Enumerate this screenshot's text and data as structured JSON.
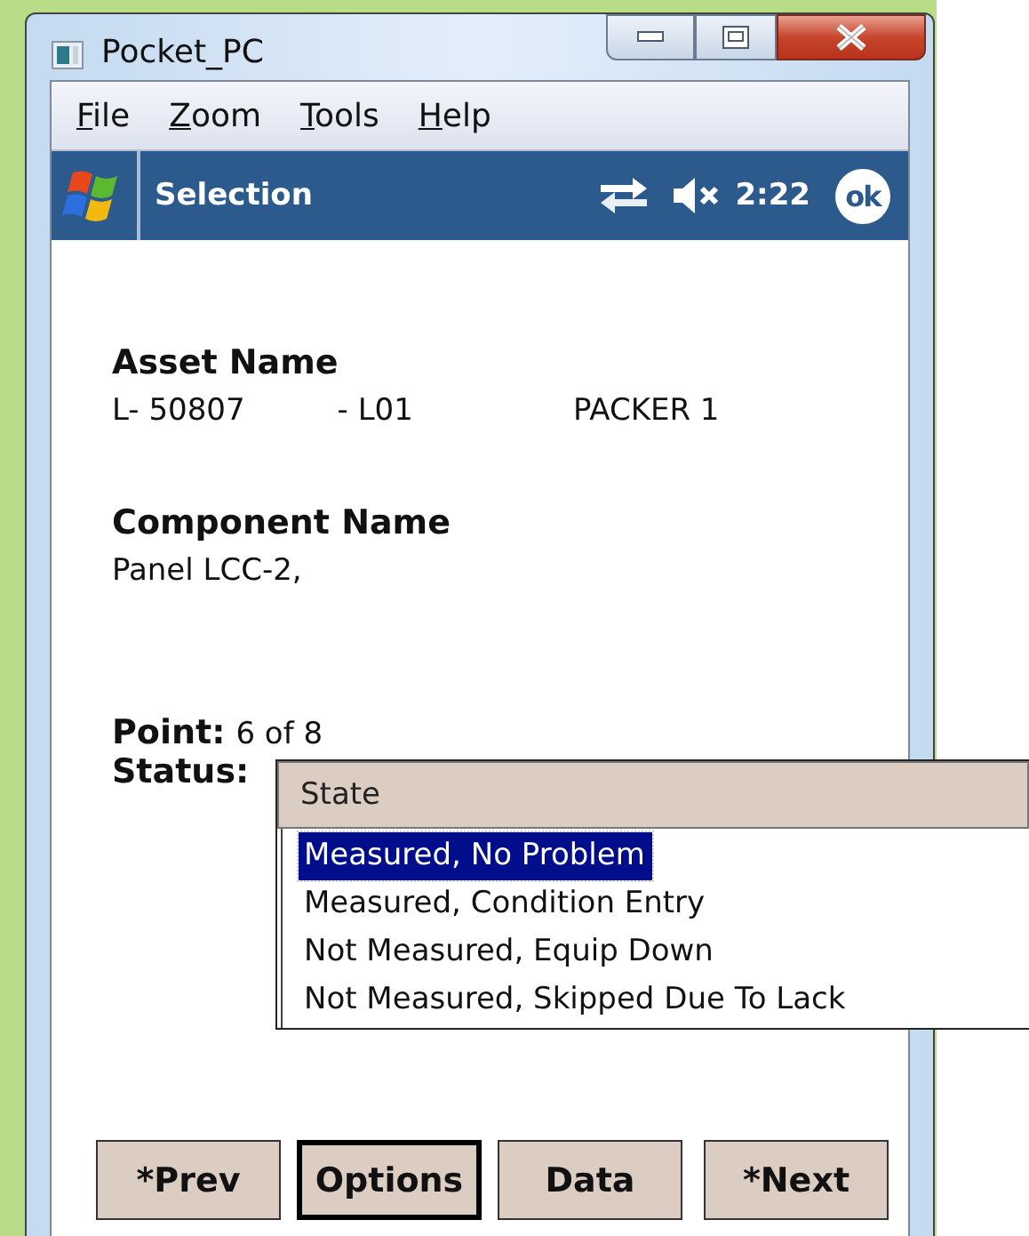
{
  "window": {
    "title": "Pocket_PC"
  },
  "menu": [
    {
      "label": "File"
    },
    {
      "label": "Zoom"
    },
    {
      "label": "Tools"
    },
    {
      "label": "Help"
    }
  ],
  "header": {
    "title": "Selection",
    "time": "2:22",
    "ok": "ok"
  },
  "asset": {
    "label": "Asset Name",
    "values": [
      "L- 50807",
      "- L01",
      "PACKER 1"
    ]
  },
  "component": {
    "label": "Component Name",
    "value": "Panel LCC-2,"
  },
  "point": {
    "label": "Point:",
    "value": "6 of 8"
  },
  "status": {
    "label": "Status:"
  },
  "dropdown": {
    "header": "State",
    "items": [
      {
        "label": "Measured, No Problem",
        "selected": true
      },
      {
        "label": "Measured, Condition Entry",
        "selected": false
      },
      {
        "label": "Not Measured, Equip Down",
        "selected": false
      },
      {
        "label": "Not Measured, Skipped Due To Lack",
        "selected": false
      }
    ]
  },
  "buttons": [
    {
      "label": "*Prev",
      "focused": false
    },
    {
      "label": "Options",
      "focused": true
    },
    {
      "label": "Data",
      "focused": false
    },
    {
      "label": "*Next",
      "focused": false
    }
  ]
}
